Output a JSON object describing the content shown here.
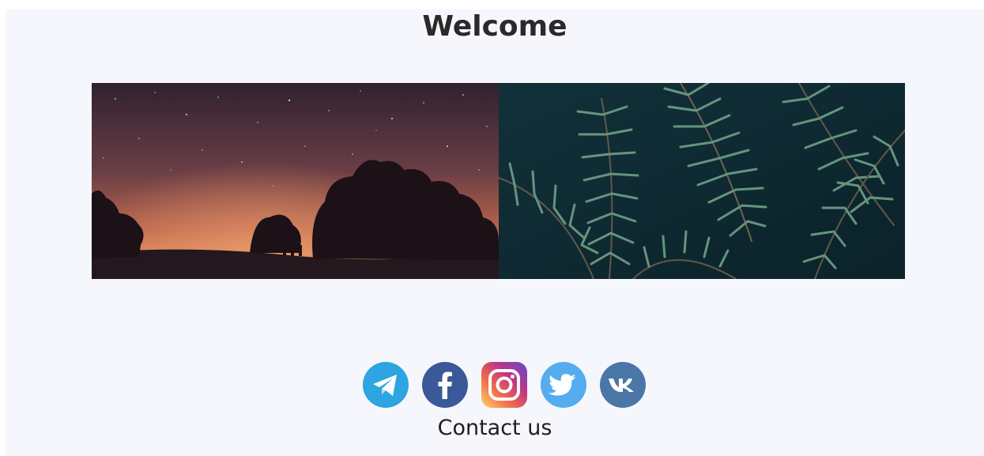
{
  "header": {
    "title": "Welcome"
  },
  "gallery": {
    "images": [
      {
        "icon": "night-sky-trees-photo"
      },
      {
        "icon": "fern-leaves-photo"
      }
    ]
  },
  "socials": [
    {
      "icon": "telegram-icon",
      "color": "#2ca5e0"
    },
    {
      "icon": "facebook-icon",
      "color": "#3b5998"
    },
    {
      "icon": "instagram-icon",
      "color": "#c13584"
    },
    {
      "icon": "twitter-icon",
      "color": "#55acee"
    },
    {
      "icon": "vk-icon",
      "color": "#4a76a8"
    }
  ],
  "footer": {
    "contact_label": "Contact us"
  }
}
